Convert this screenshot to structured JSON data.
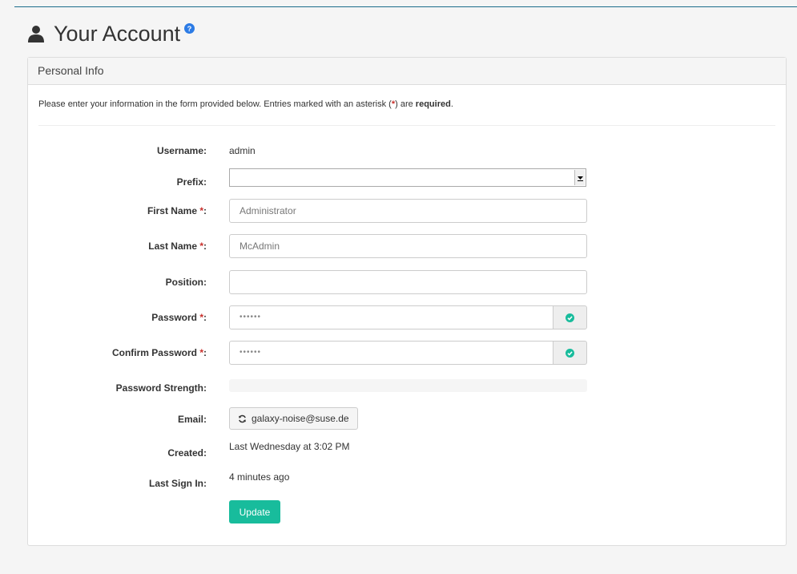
{
  "page": {
    "title": "Your Account"
  },
  "panel": {
    "heading": "Personal Info",
    "intro_before": "Please enter your information in the form provided below. Entries marked with an asterisk (",
    "intro_star": "*",
    "intro_middle": ") are ",
    "intro_required": "required",
    "intro_end": "."
  },
  "form": {
    "required_mark": "*",
    "username": {
      "label": "Username:",
      "value": "admin"
    },
    "prefix": {
      "label": "Prefix:",
      "value": ""
    },
    "first_name": {
      "label": "First Name ",
      "suffix": ":",
      "placeholder": "Administrator"
    },
    "last_name": {
      "label": "Last Name ",
      "suffix": ":",
      "placeholder": "McAdmin"
    },
    "position": {
      "label": "Position:",
      "value": ""
    },
    "password": {
      "label": "Password ",
      "suffix": ":",
      "value": "••••••",
      "status_icon": "check-circle-icon",
      "status_color": "#18bc9c"
    },
    "confirm_password": {
      "label": "Confirm Password ",
      "suffix": ":",
      "value": "••••••",
      "status_icon": "check-circle-icon",
      "status_color": "#18bc9c"
    },
    "password_strength": {
      "label": "Password Strength:",
      "level": 0
    },
    "email": {
      "label": "Email:",
      "value": "galaxy-noise@suse.de",
      "icon": "refresh-icon"
    },
    "created": {
      "label": "Created:",
      "value": "Last Wednesday at 3:02 PM"
    },
    "last_sign_in": {
      "label": "Last Sign In:",
      "value": "4 minutes ago"
    },
    "update_button": "Update"
  },
  "colors": {
    "accent": "#18bc9c",
    "required": "#c9302c"
  }
}
